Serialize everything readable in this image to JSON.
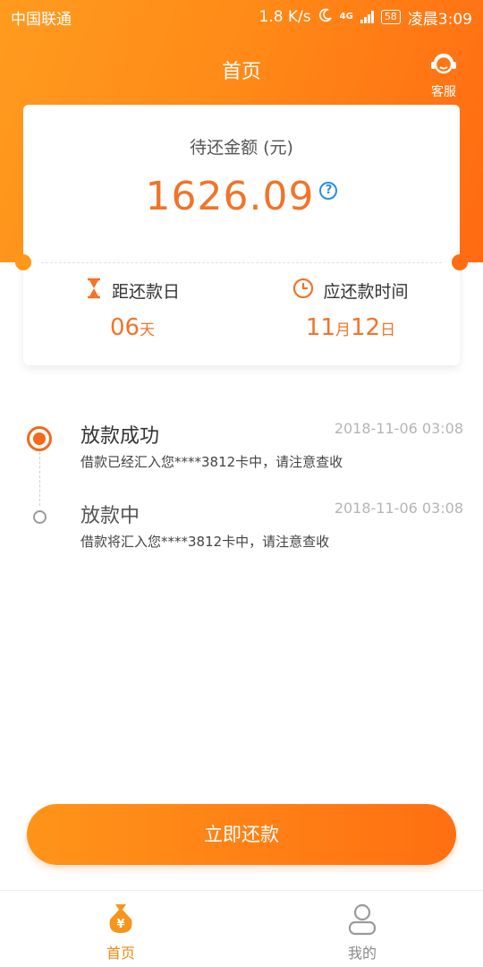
{
  "status_bar": {
    "carrier": "中国联通",
    "speed": "1.8 K/s",
    "network": "4G",
    "battery": "58",
    "time": "凌晨3:09"
  },
  "header": {
    "title": "首页",
    "service_label": "客服"
  },
  "summary": {
    "label": "待还金额 (元)",
    "amount": "1626.09",
    "help_icon": "question-circle-icon",
    "days_label": "距还款日",
    "days_value": "06",
    "days_unit": "天",
    "due_label": "应还款时间",
    "due_month": "11",
    "due_month_unit": "月",
    "due_day": "12",
    "due_day_unit": "日"
  },
  "timeline": [
    {
      "title": "放款成功",
      "time": "2018-11-06 03:08",
      "desc": "借款已经汇入您****3812卡中，请注意查收"
    },
    {
      "title": "放款中",
      "time": "2018-11-06 03:08",
      "desc": "借款将汇入您****3812卡中，请注意查收"
    }
  ],
  "repay_button": "立即还款",
  "tabs": [
    {
      "label": "首页",
      "icon": "money-bag-icon",
      "active": true
    },
    {
      "label": "我的",
      "icon": "person-icon",
      "active": false
    }
  ],
  "colors": {
    "accent": "#f0742a",
    "hero_start": "#ff9b1f",
    "hero_end": "#ff6a12",
    "help": "#2a8fdc"
  }
}
